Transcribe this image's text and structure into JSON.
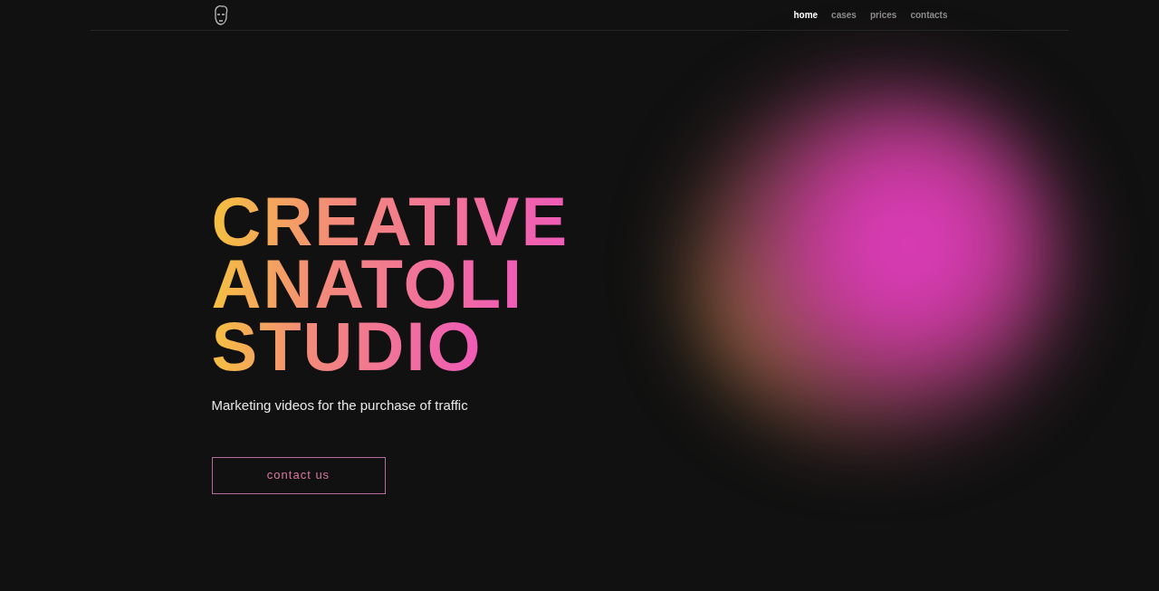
{
  "nav": [
    {
      "label": "home",
      "selected": true
    },
    {
      "label": "cases",
      "selected": false
    },
    {
      "label": "prices",
      "selected": false
    },
    {
      "label": "contacts",
      "selected": false
    }
  ],
  "hero": {
    "title_lines": [
      "CREATIVE",
      "ANATOLI",
      "STUDIO"
    ],
    "subtitle": "Marketing videos for the purchase of traffic",
    "button": "contact us"
  }
}
